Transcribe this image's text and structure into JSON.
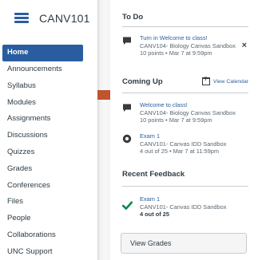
{
  "course": {
    "name": "CANV101"
  },
  "nav": {
    "items": [
      {
        "label": "Home",
        "active": true
      },
      {
        "label": "Announcements"
      },
      {
        "label": "Syllabus"
      },
      {
        "label": "Modules"
      },
      {
        "label": "Assignments"
      },
      {
        "label": "Discussions"
      },
      {
        "label": "Quizzes"
      },
      {
        "label": "Grades"
      },
      {
        "label": "Conferences"
      },
      {
        "label": "Files"
      },
      {
        "label": "People"
      },
      {
        "label": "Collaborations"
      },
      {
        "label": "UNC Support"
      }
    ]
  },
  "todo": {
    "heading": "To Do",
    "items": [
      {
        "icon": "discussion-icon",
        "title": "Turn in Welcome to class!",
        "course": "CANV104- Biology Canvas Sandbox",
        "meta": "10 points • Mar 7 at 9:59pm",
        "dismiss": "×"
      }
    ]
  },
  "coming_up": {
    "heading": "Coming Up",
    "view_calendar": "View Calendar",
    "items": [
      {
        "icon": "discussion-icon",
        "title": "Welcome to class!",
        "course": "CANV104- Biology Canvas Sandbox",
        "meta": "10 points • Mar 7 at 9:59pm"
      },
      {
        "icon": "quiz-icon",
        "title": "Exam 1",
        "course": "CANV101- Canvas IDD Sandbox",
        "meta": "4 out of 25 • Mar 7 at 11:59pm"
      }
    ]
  },
  "recent_feedback": {
    "heading": "Recent Feedback",
    "items": [
      {
        "icon": "checkmark-icon",
        "title": "Exam 1",
        "course": "CANV101- Canvas IDD Sandbox",
        "score": "4 out of 25"
      }
    ]
  },
  "view_grades": "View Grades",
  "colors": {
    "brand": "#2a5d9f",
    "accent": "#c0542e",
    "success": "#0b874b"
  }
}
